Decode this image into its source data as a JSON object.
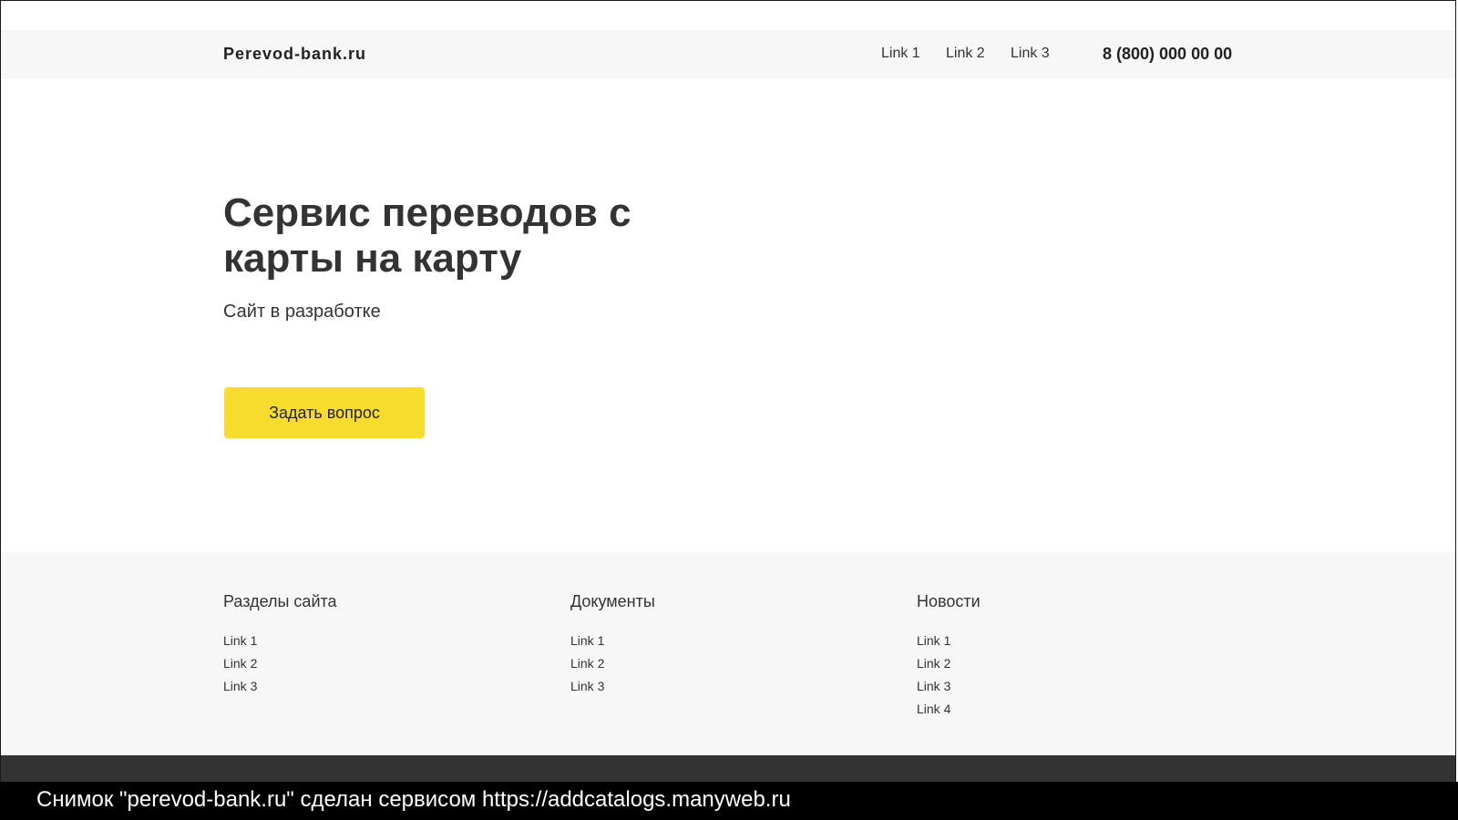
{
  "header": {
    "logo": "Perevod-bank.ru",
    "nav": [
      "Link 1",
      "Link 2",
      "Link 3"
    ],
    "phone": "8 (800) 000 00 00"
  },
  "hero": {
    "title_line1": "Сервис переводов с",
    "title_line2": "карты на карту",
    "subtitle": "Сайт в разработке",
    "cta_label": "Задать вопрос"
  },
  "footer": {
    "columns": [
      {
        "title": "Разделы сайта",
        "links": [
          "Link 1",
          "Link 2",
          "Link 3"
        ]
      },
      {
        "title": "Документы",
        "links": [
          "Link 1",
          "Link 2",
          "Link 3"
        ]
      },
      {
        "title": "Новости",
        "links": [
          "Link 1",
          "Link 2",
          "Link 3",
          "Link 4"
        ]
      }
    ]
  },
  "caption": "Снимок \"perevod-bank.ru\" сделан сервисом https://addcatalogs.manyweb.ru",
  "colors": {
    "accent": "#f8dc2d",
    "header_bg": "#f7f7f7",
    "footer_bg": "#f7f7f7",
    "bottom_bar": "#333333",
    "text": "#333333"
  }
}
